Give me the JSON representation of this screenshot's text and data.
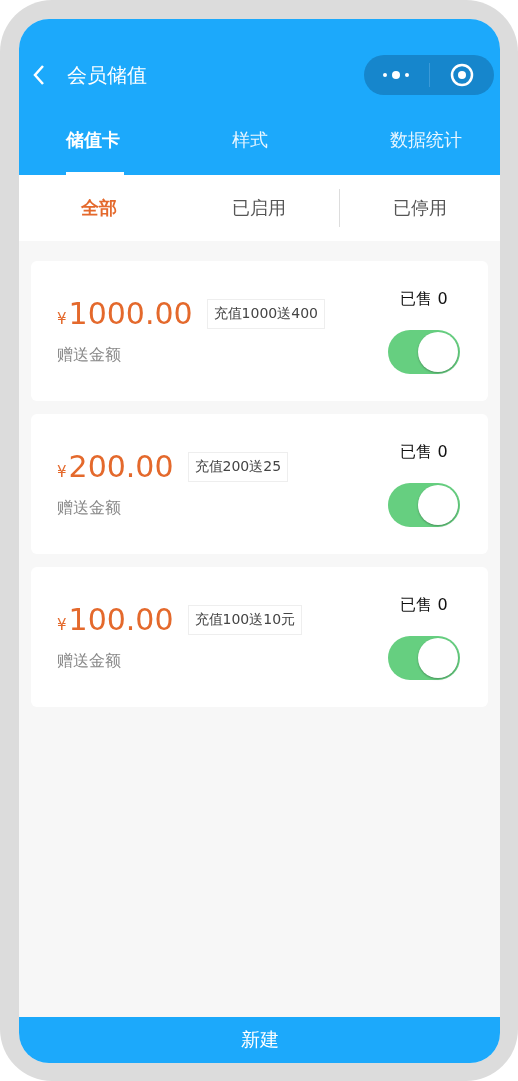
{
  "nav": {
    "title": "会员储值"
  },
  "tabs": [
    {
      "label": "储值卡",
      "selected": true
    },
    {
      "label": "样式",
      "selected": false
    },
    {
      "label": "数据统计",
      "selected": false
    }
  ],
  "filters": [
    {
      "label": "全部",
      "selected": true
    },
    {
      "label": "已启用",
      "selected": false
    },
    {
      "label": "已停用",
      "selected": false
    }
  ],
  "cards": [
    {
      "currency": "¥",
      "amount": "1000.00",
      "tag": "充值1000送400",
      "label": "赠送金额",
      "sold": "已售 0",
      "on": true
    },
    {
      "currency": "¥",
      "amount": "200.00",
      "tag": "充值200送25",
      "label": "赠送金额",
      "sold": "已售 0",
      "on": true
    },
    {
      "currency": "¥",
      "amount": "100.00",
      "tag": "充值100送10元",
      "label": "赠送金额",
      "sold": "已售 0",
      "on": true
    }
  ],
  "button": "新建"
}
